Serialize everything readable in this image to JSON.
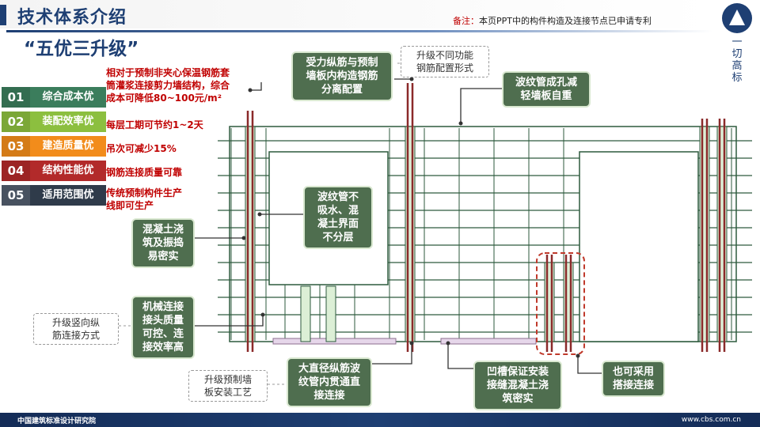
{
  "header": {
    "title": "技术体系介绍",
    "note_label": "备注：",
    "note_text": "本页PPT中的构件构造及连接节点已申请专利"
  },
  "logo": {
    "text": "一切高标"
  },
  "subtitle": "“五优三升级”",
  "advantages": [
    {
      "num": "01",
      "label": "综合成本优",
      "color": "#3b7d5c",
      "desc_lines": [
        "相对于预制非夹心保温钢筋套",
        "筒灌浆连接剪力墙结构，综合",
        "成本可降低80~100元/m²"
      ]
    },
    {
      "num": "02",
      "label": "装配效率优",
      "color": "#8cbf3f",
      "desc_lines": [
        "每层工期可节约1~2天"
      ]
    },
    {
      "num": "03",
      "label": "建造质量优",
      "color": "#f28c1b",
      "desc_lines": [
        "吊次可减少15%"
      ]
    },
    {
      "num": "04",
      "label": "结构性能优",
      "color": "#b22a2a",
      "desc_lines": [
        "钢筋连接质量可靠"
      ]
    },
    {
      "num": "05",
      "label": "适用范围优",
      "color": "#2f3b4a",
      "desc_lines": [
        "传统预制构件生产",
        "线即可生产"
      ]
    }
  ],
  "callouts": {
    "rebar_separation": [
      "受力纵筋与预制",
      "墙板内构造钢筋",
      "分离配置"
    ],
    "upgrade_rebar_config": [
      "升级不同功能",
      "钢筋配置形式"
    ],
    "corrugated_pipe_hole": [
      "波纹管成孔减",
      "轻墙板自重"
    ],
    "pipe_no_water": [
      "波纹管不",
      "吸水、混",
      "凝土界面",
      "不分层"
    ],
    "concrete_pour": [
      "混凝土浇",
      "筑及振捣",
      "易密实"
    ],
    "mechanical_connection": [
      "机械连接",
      "接头质量",
      "可控、连",
      "接效率高"
    ],
    "upgrade_vertical": [
      "升级竖向纵",
      "筋连接方式"
    ],
    "upgrade_install": [
      "升级预制墙",
      "板安装工艺"
    ],
    "large_dia_rebar": [
      "大直径纵筋波",
      "纹管内贯通直",
      "接连接"
    ],
    "groove_seam": [
      "凹槽保证安装",
      "接缝混凝土浇",
      "筑密实"
    ],
    "lap_connection": [
      "也可采用",
      "搭接连接"
    ]
  },
  "footer": {
    "left": "中国建筑标准设计研究院",
    "right": "www.cbs.com.cn"
  },
  "colors": {
    "brand": "#1e3f73",
    "callout_bg": "#4f6e4f",
    "rebar_red": "#8b2a2a",
    "rebar_green": "#2d5a3d",
    "note_red": "#c00000"
  }
}
